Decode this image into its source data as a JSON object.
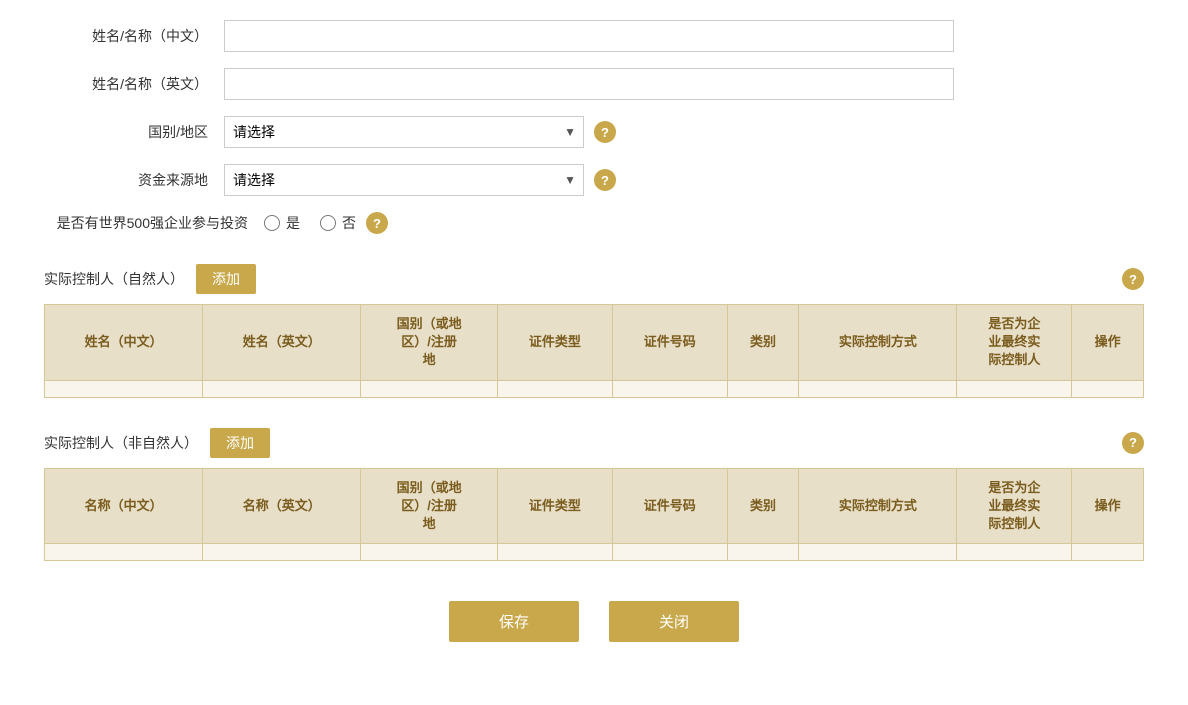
{
  "form": {
    "name_cn_label": "姓名/名称（中文）",
    "name_en_label": "姓名/名称（英文）",
    "country_label": "国别/地区",
    "fund_source_label": "资金来源地",
    "world500_label": "是否有世界500强企业参与投资",
    "select_placeholder": "请选择",
    "radio_yes": "是",
    "radio_no": "否"
  },
  "sections": {
    "natural_person": {
      "title": "实际控制人（自然人）",
      "add_label": "添加",
      "columns": [
        "姓名（中文）",
        "姓名（英文）",
        "国别（或地\n区）/注册\n地",
        "证件类型",
        "证件号码",
        "类别",
        "实际控制方式",
        "是否为企\n业最终实\n际控制人",
        "操作"
      ]
    },
    "non_natural_person": {
      "title": "实际控制人（非自然人）",
      "add_label": "添加",
      "columns": [
        "名称（中文）",
        "名称（英文）",
        "国别（或地\n区）/注册\n地",
        "证件类型",
        "证件号码",
        "类别",
        "实际控制方式",
        "是否为企\n业最终实\n际控制人",
        "操作"
      ]
    }
  },
  "buttons": {
    "save": "保存",
    "close": "关闭"
  },
  "help_icon": "?",
  "icons": {
    "dropdown_arrow": "▼"
  }
}
